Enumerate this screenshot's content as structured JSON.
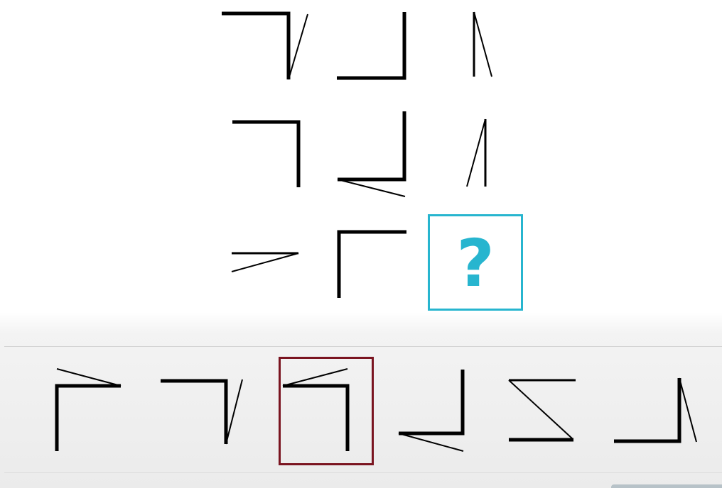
{
  "puzzle": {
    "missing_cell_symbol": "?",
    "grid_rows": 3,
    "grid_columns": 3,
    "highlight_color": "#27b5cf"
  },
  "answer_options": {
    "count": 6,
    "selected_index": 3,
    "selection_color": "#7a1420"
  }
}
